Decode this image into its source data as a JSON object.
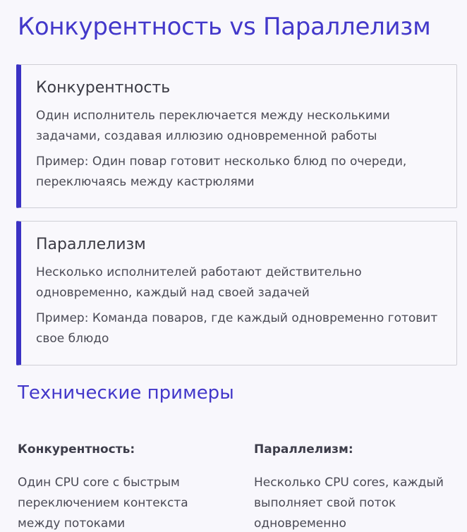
{
  "page": {
    "title": "Конкурентность vs Параллелизм"
  },
  "cards": [
    {
      "title": "Конкурентность",
      "description": "Один исполнитель переключается между несколькими задачами, создавая иллюзию одновременной работы",
      "example": "Пример: Один повар готовит несколько блюд по очереди, переключаясь между кастрюлями"
    },
    {
      "title": "Параллелизм",
      "description": "Несколько исполнителей работают действительно одновременно, каждый над своей задачей",
      "example": "Пример: Команда поваров, где каждый одновременно готовит свое блюдо"
    }
  ],
  "tech": {
    "title": "Технические примеры",
    "columns": [
      {
        "heading": "Конкурентность:",
        "text": "Один CPU core с быстрым переключением контекста между потоками"
      },
      {
        "heading": "Параллелизм:",
        "text": "Несколько CPU cores, каждый выполняет свой поток одновременно"
      }
    ]
  },
  "colors": {
    "accent": "#4338ca",
    "card_border": "#3b32c4",
    "background": "#f8f7fc"
  }
}
